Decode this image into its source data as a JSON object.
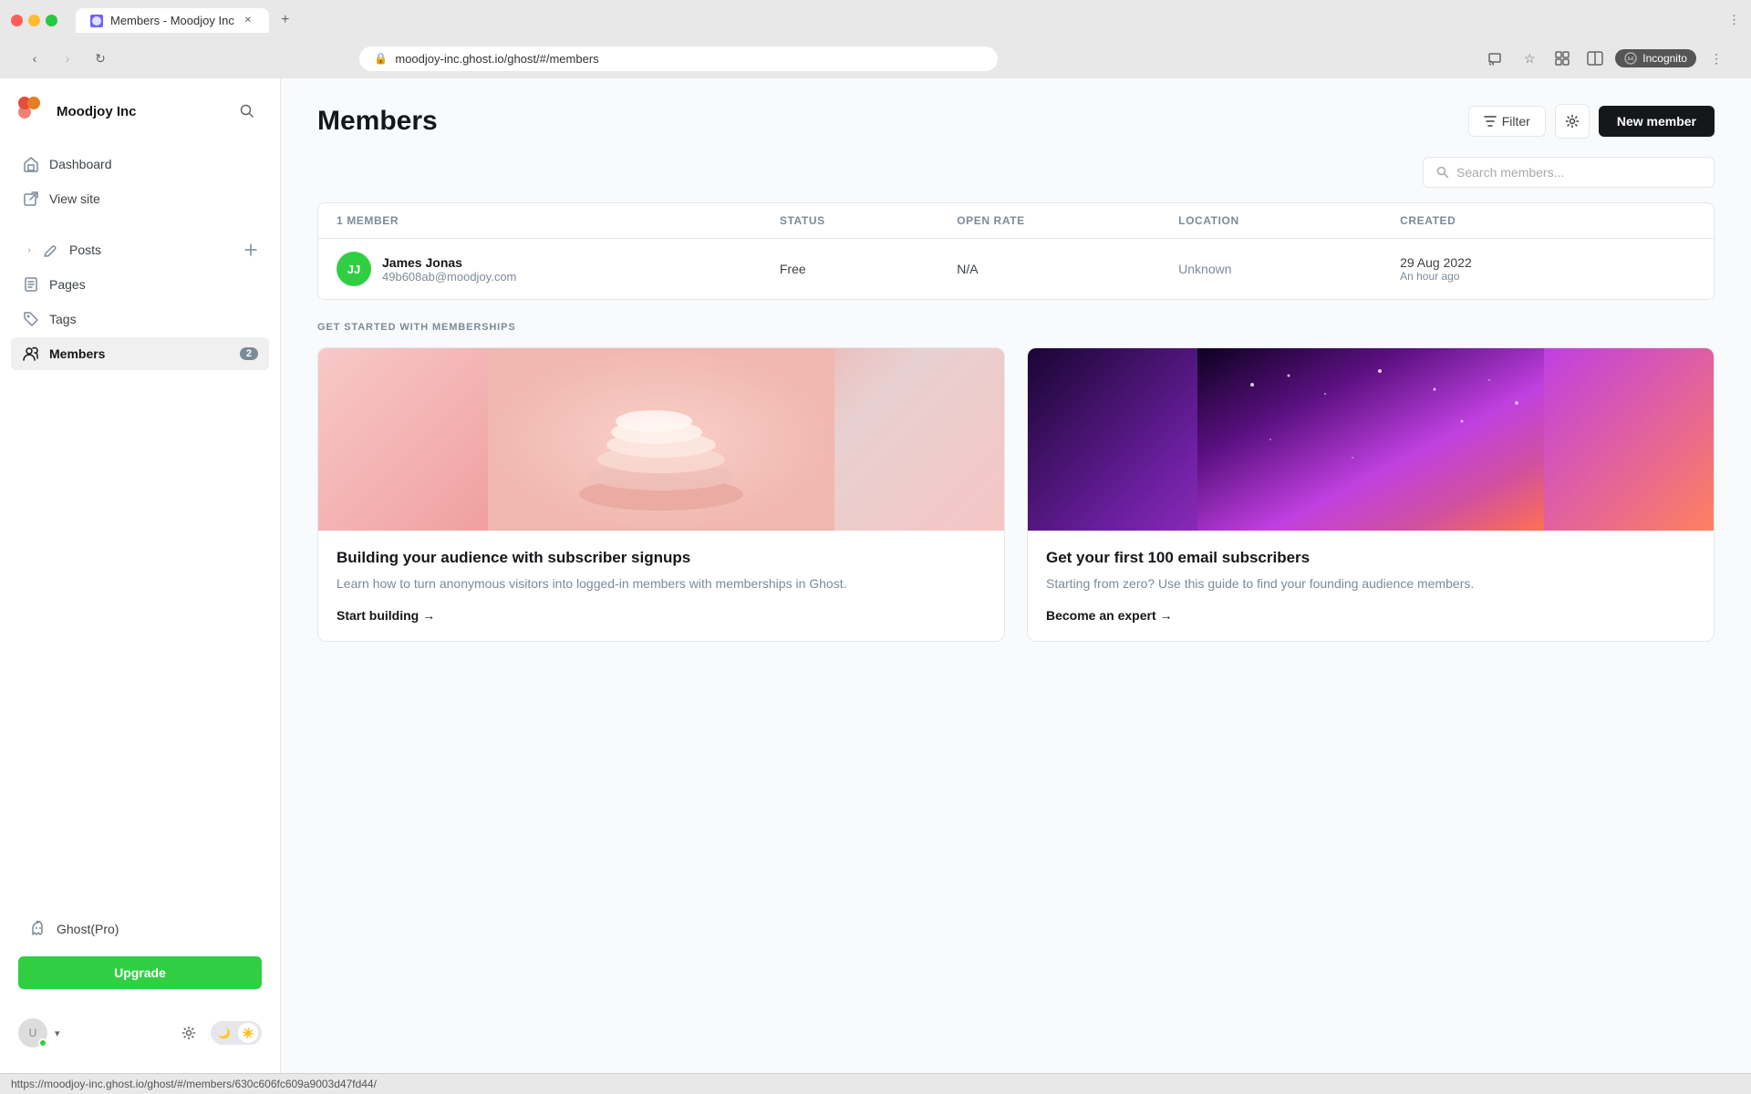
{
  "browser": {
    "tab_title": "Members - Moodjoy Inc",
    "address": "moodjoy-inc.ghost.io/ghost/#/members",
    "new_tab_label": "+",
    "incognito_label": "Incognito"
  },
  "sidebar": {
    "brand_name": "Moodjoy Inc",
    "nav_items": [
      {
        "id": "dashboard",
        "label": "Dashboard",
        "icon": "home"
      },
      {
        "id": "view-site",
        "label": "View site",
        "icon": "external"
      }
    ],
    "nav_items2": [
      {
        "id": "posts",
        "label": "Posts",
        "icon": "edit",
        "add": true
      },
      {
        "id": "pages",
        "label": "Pages",
        "icon": "pages"
      },
      {
        "id": "tags",
        "label": "Tags",
        "icon": "tag"
      },
      {
        "id": "members",
        "label": "Members",
        "icon": "members",
        "badge": "2",
        "active": true
      }
    ],
    "nav_items3": [
      {
        "id": "ghost-pro",
        "label": "Ghost(Pro)",
        "icon": "ghost"
      }
    ],
    "upgrade_label": "Upgrade",
    "user_chevron": "▾"
  },
  "header": {
    "title": "Members",
    "filter_label": "Filter",
    "new_member_label": "New member"
  },
  "search": {
    "placeholder": "Search members..."
  },
  "table": {
    "member_count_label": "1 MEMBER",
    "columns": {
      "member": "MEMBER",
      "status": "STATUS",
      "open_rate": "OPEN RATE",
      "location": "LOCATION",
      "created": "CREATED"
    },
    "rows": [
      {
        "avatar_initials": "JJ",
        "avatar_bg": "#30cf43",
        "name": "James Jonas",
        "email": "49b608ab@moodjoy.com",
        "status": "Free",
        "open_rate": "N/A",
        "location": "Unknown",
        "created_date": "29 Aug 2022",
        "created_ago": "An hour ago"
      }
    ]
  },
  "get_started": {
    "section_label": "GET STARTED WITH MEMBERSHIPS",
    "cards": [
      {
        "title": "Building your audience with subscriber signups",
        "description": "Learn how to turn anonymous visitors into logged-in members with memberships in Ghost.",
        "link_label": "Start building →"
      },
      {
        "title": "Get your first 100 email subscribers",
        "description": "Starting from zero? Use this guide to find your founding audience members.",
        "link_label": "Become an expert →"
      }
    ]
  },
  "status_bar": {
    "url": "https://moodjoy-inc.ghost.io/ghost/#/members/630c606fc609a9003d47fd44/"
  }
}
